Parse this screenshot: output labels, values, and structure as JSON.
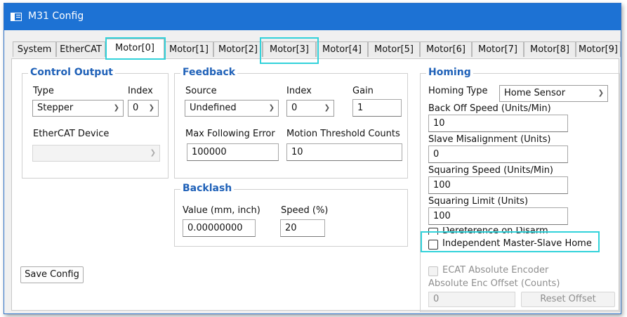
{
  "window": {
    "title": "M31 Config"
  },
  "tabs": [
    "System",
    "EtherCAT",
    "Motor[0]",
    "Motor[1]",
    "Motor[2]",
    "Motor[3]",
    "Motor[4]",
    "Motor[5]",
    "Motor[6]",
    "Motor[7]",
    "Motor[8]",
    "Motor[9]"
  ],
  "control_output": {
    "title": "Control Output",
    "type_label": "Type",
    "type_value": "Stepper",
    "index_label": "Index",
    "index_value": "0",
    "device_label": "EtherCAT Device",
    "device_value": ""
  },
  "feedback": {
    "title": "Feedback",
    "source_label": "Source",
    "source_value": "Undefined",
    "index_label": "Index",
    "index_value": "0",
    "gain_label": "Gain",
    "gain_value": "1",
    "mfe_label": "Max Following Error",
    "mfe_value": "100000",
    "mtc_label": "Motion Threshold Counts",
    "mtc_value": "10"
  },
  "backlash": {
    "title": "Backlash",
    "value_label": "Value (mm, inch)",
    "value_value": "0.00000000",
    "speed_label": "Speed (%)",
    "speed_value": "20"
  },
  "homing": {
    "title": "Homing",
    "type_label": "Homing Type",
    "type_value": "Home Sensor",
    "backoff_label": "Back Off Speed (Units/Min)",
    "backoff_value": "10",
    "misalign_label": "Slave Misalignment (Units)",
    "misalign_value": "0",
    "squaring_speed_label": "Squaring Speed (Units/Min)",
    "squaring_speed_value": "100",
    "squaring_limit_label": "Squaring Limit (Units)",
    "squaring_limit_value": "100",
    "dereference_label": "Dereference on Disarm",
    "independent_label": "Independent Master-Slave Home",
    "ecat_label": "ECAT Absolute Encoder",
    "abs_offset_label": "Absolute Enc Offset (Counts)",
    "abs_offset_value": "0",
    "reset_offset_label": "Reset Offset"
  },
  "save_config_label": "Save Config"
}
